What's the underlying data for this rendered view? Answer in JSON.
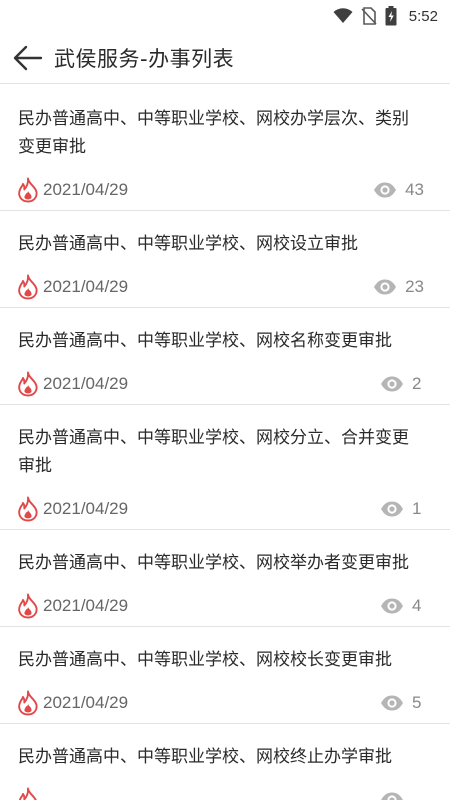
{
  "status_bar": {
    "time": "5:52"
  },
  "header": {
    "title": "武侯服务-办事列表"
  },
  "items": [
    {
      "title": "民办普通高中、中等职业学校、网校办学层次、类别变更审批",
      "date": "2021/04/29",
      "views": "43"
    },
    {
      "title": "民办普通高中、中等职业学校、网校设立审批",
      "date": "2021/04/29",
      "views": "23"
    },
    {
      "title": "民办普通高中、中等职业学校、网校名称变更审批",
      "date": "2021/04/29",
      "views": "2"
    },
    {
      "title": "民办普通高中、中等职业学校、网校分立、合并变更审批",
      "date": "2021/04/29",
      "views": "1"
    },
    {
      "title": "民办普通高中、中等职业学校、网校举办者变更审批",
      "date": "2021/04/29",
      "views": "4"
    },
    {
      "title": "民办普通高中、中等职业学校、网校校长变更审批",
      "date": "2021/04/29",
      "views": "5"
    },
    {
      "title": "民办普通高中、中等职业学校、网校终止办学审批",
      "date": "",
      "views": ""
    }
  ],
  "icons": {
    "fire": "fire-icon",
    "eye": "eye-icon",
    "back": "back-arrow-icon"
  },
  "colors": {
    "fire": "#e0484a",
    "eye": "#b5b5b5"
  }
}
